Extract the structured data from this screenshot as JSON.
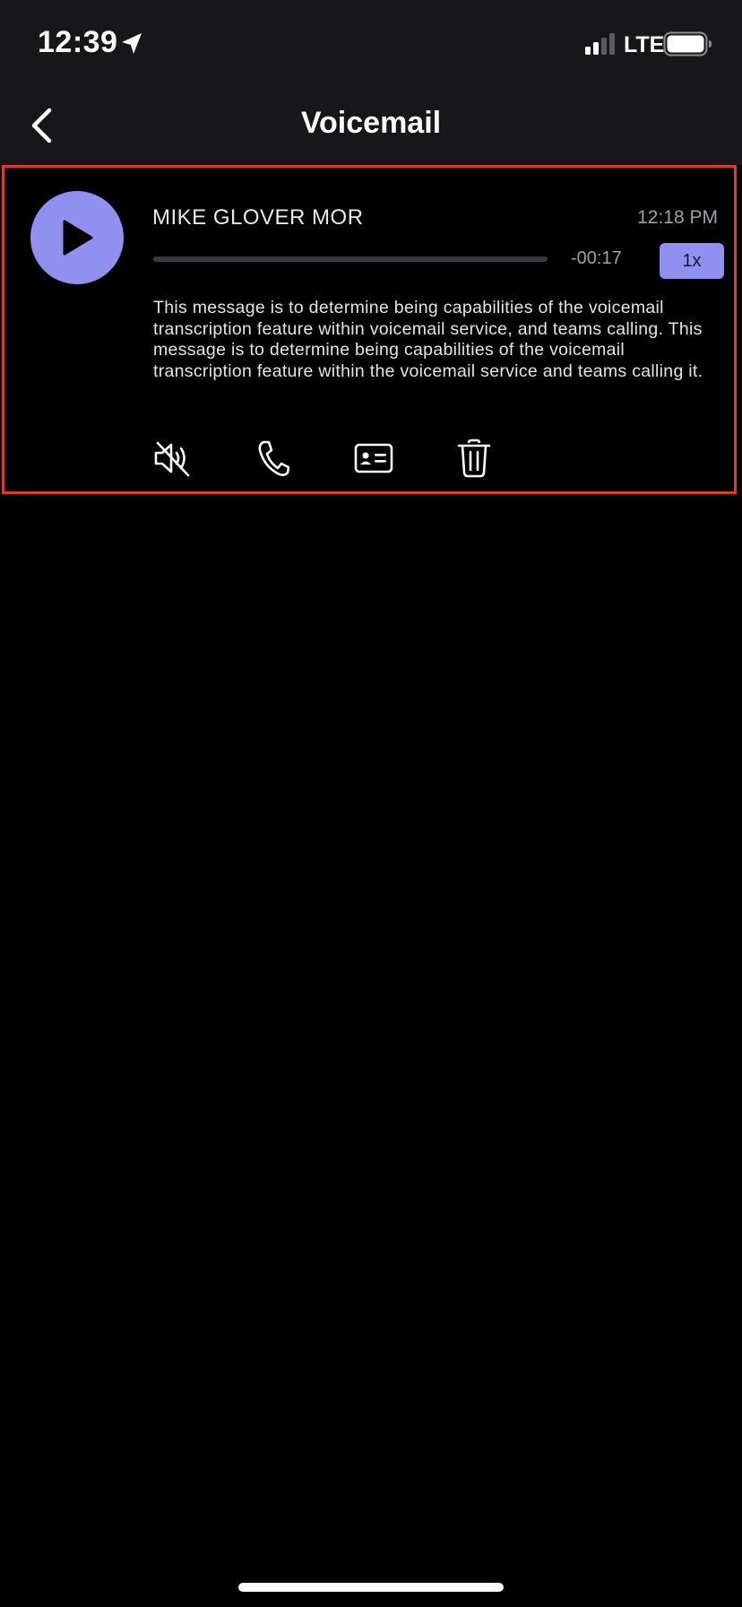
{
  "status_bar": {
    "time": "12:39",
    "network": "LTE",
    "icons": [
      "location-arrow-icon",
      "cellular-signal-icon",
      "battery-icon"
    ]
  },
  "nav": {
    "title": "Voicemail",
    "back_icon": "chevron-left-icon"
  },
  "voicemail": {
    "caller_name": "MIKE GLOVER MOR",
    "time": "12:18 PM",
    "remaining": "-00:17",
    "speed": "1x",
    "progress_fraction": 0,
    "transcript": "This message is to determine being capabilities of the voicemail transcription feature within voicemail service, and teams calling. This message is to determine being capabilities of the voicemail transcription feature within the voicemail service and teams calling it.",
    "actions": [
      {
        "name": "mute-speaker-button",
        "icon": "speaker-muted-icon"
      },
      {
        "name": "call-back-button",
        "icon": "phone-icon"
      },
      {
        "name": "contact-card-button",
        "icon": "contact-card-icon"
      },
      {
        "name": "delete-button",
        "icon": "trash-icon"
      }
    ]
  },
  "colors": {
    "accent": "#8f90f0",
    "highlight_border": "#e13a2c",
    "header_bg": "#171719",
    "background": "#000000"
  }
}
